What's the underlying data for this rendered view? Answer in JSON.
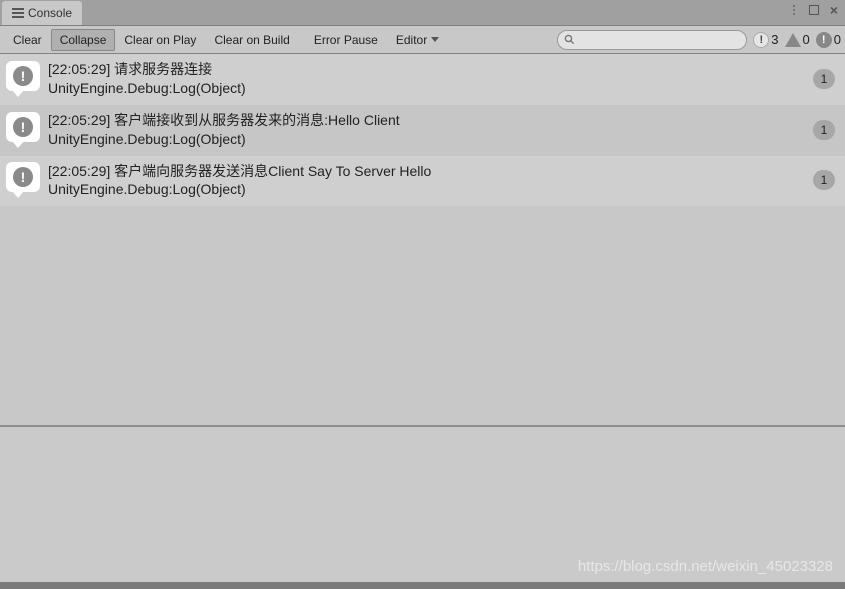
{
  "tab": {
    "title": "Console"
  },
  "toolbar": {
    "clear": "Clear",
    "collapse": "Collapse",
    "clear_on_play": "Clear on Play",
    "clear_on_build": "Clear on Build",
    "error_pause": "Error Pause",
    "editor": "Editor",
    "search_placeholder": ""
  },
  "counters": {
    "info": "3",
    "warn": "0",
    "error": "0"
  },
  "logs": [
    {
      "message": "[22:05:29] 请求服务器连接",
      "trace": "UnityEngine.Debug:Log(Object)",
      "count": "1"
    },
    {
      "message": "[22:05:29] 客户端接收到从服务器发来的消息:Hello Client",
      "trace": "UnityEngine.Debug:Log(Object)",
      "count": "1"
    },
    {
      "message": "[22:05:29] 客户端向服务器发送消息Client Say To Server Hello",
      "trace": "UnityEngine.Debug:Log(Object)",
      "count": "1"
    }
  ],
  "watermark": "https://blog.csdn.net/weixin_45023328"
}
